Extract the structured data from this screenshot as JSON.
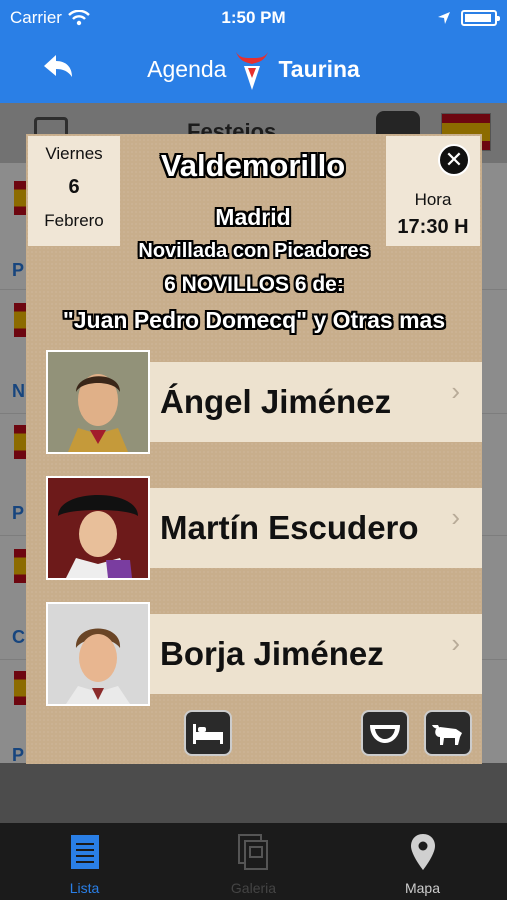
{
  "status": {
    "carrier": "Carrier",
    "time": "1:50 PM"
  },
  "nav": {
    "brand_left": "Agenda",
    "brand_right": "Taurina"
  },
  "list": {
    "title": "Festejos",
    "row_letters": [
      "P",
      "N",
      "P",
      "C",
      "P"
    ]
  },
  "event": {
    "day_of_week": "Viernes",
    "day": "6",
    "month": "Febrero",
    "time_label": "Hora",
    "time_value": "17:30 H",
    "town": "Valdemorillo",
    "province": "Madrid",
    "type": "Novillada con Picadores",
    "cattle_count": "6 NOVILLOS 6 de:",
    "ganaderia": "\"Juan Pedro Domecq\" y Otras mas"
  },
  "toreros": [
    {
      "name": "Ángel Jiménez"
    },
    {
      "name": "Martín Escudero"
    },
    {
      "name": "Borja Jiménez"
    }
  ],
  "tabs": [
    {
      "label": "Lista",
      "state": "active"
    },
    {
      "label": "Galeria",
      "state": "disabled"
    },
    {
      "label": "Mapa",
      "state": "normal"
    }
  ],
  "colors": {
    "accent": "#2a7fe6",
    "card": "#c8ae8c",
    "name_box": "#ede2cf"
  }
}
